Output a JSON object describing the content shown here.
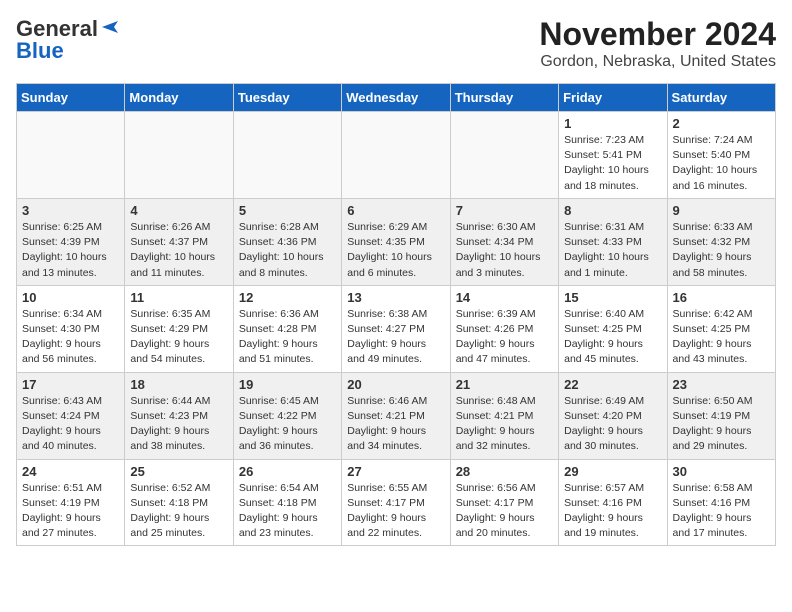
{
  "logo": {
    "line1": "General",
    "line2": "Blue"
  },
  "title": "November 2024",
  "subtitle": "Gordon, Nebraska, United States",
  "weekdays": [
    "Sunday",
    "Monday",
    "Tuesday",
    "Wednesday",
    "Thursday",
    "Friday",
    "Saturday"
  ],
  "weeks": [
    [
      {
        "day": "",
        "info": ""
      },
      {
        "day": "",
        "info": ""
      },
      {
        "day": "",
        "info": ""
      },
      {
        "day": "",
        "info": ""
      },
      {
        "day": "",
        "info": ""
      },
      {
        "day": "1",
        "info": "Sunrise: 7:23 AM\nSunset: 5:41 PM\nDaylight: 10 hours and 18 minutes."
      },
      {
        "day": "2",
        "info": "Sunrise: 7:24 AM\nSunset: 5:40 PM\nDaylight: 10 hours and 16 minutes."
      }
    ],
    [
      {
        "day": "3",
        "info": "Sunrise: 6:25 AM\nSunset: 4:39 PM\nDaylight: 10 hours and 13 minutes."
      },
      {
        "day": "4",
        "info": "Sunrise: 6:26 AM\nSunset: 4:37 PM\nDaylight: 10 hours and 11 minutes."
      },
      {
        "day": "5",
        "info": "Sunrise: 6:28 AM\nSunset: 4:36 PM\nDaylight: 10 hours and 8 minutes."
      },
      {
        "day": "6",
        "info": "Sunrise: 6:29 AM\nSunset: 4:35 PM\nDaylight: 10 hours and 6 minutes."
      },
      {
        "day": "7",
        "info": "Sunrise: 6:30 AM\nSunset: 4:34 PM\nDaylight: 10 hours and 3 minutes."
      },
      {
        "day": "8",
        "info": "Sunrise: 6:31 AM\nSunset: 4:33 PM\nDaylight: 10 hours and 1 minute."
      },
      {
        "day": "9",
        "info": "Sunrise: 6:33 AM\nSunset: 4:32 PM\nDaylight: 9 hours and 58 minutes."
      }
    ],
    [
      {
        "day": "10",
        "info": "Sunrise: 6:34 AM\nSunset: 4:30 PM\nDaylight: 9 hours and 56 minutes."
      },
      {
        "day": "11",
        "info": "Sunrise: 6:35 AM\nSunset: 4:29 PM\nDaylight: 9 hours and 54 minutes."
      },
      {
        "day": "12",
        "info": "Sunrise: 6:36 AM\nSunset: 4:28 PM\nDaylight: 9 hours and 51 minutes."
      },
      {
        "day": "13",
        "info": "Sunrise: 6:38 AM\nSunset: 4:27 PM\nDaylight: 9 hours and 49 minutes."
      },
      {
        "day": "14",
        "info": "Sunrise: 6:39 AM\nSunset: 4:26 PM\nDaylight: 9 hours and 47 minutes."
      },
      {
        "day": "15",
        "info": "Sunrise: 6:40 AM\nSunset: 4:25 PM\nDaylight: 9 hours and 45 minutes."
      },
      {
        "day": "16",
        "info": "Sunrise: 6:42 AM\nSunset: 4:25 PM\nDaylight: 9 hours and 43 minutes."
      }
    ],
    [
      {
        "day": "17",
        "info": "Sunrise: 6:43 AM\nSunset: 4:24 PM\nDaylight: 9 hours and 40 minutes."
      },
      {
        "day": "18",
        "info": "Sunrise: 6:44 AM\nSunset: 4:23 PM\nDaylight: 9 hours and 38 minutes."
      },
      {
        "day": "19",
        "info": "Sunrise: 6:45 AM\nSunset: 4:22 PM\nDaylight: 9 hours and 36 minutes."
      },
      {
        "day": "20",
        "info": "Sunrise: 6:46 AM\nSunset: 4:21 PM\nDaylight: 9 hours and 34 minutes."
      },
      {
        "day": "21",
        "info": "Sunrise: 6:48 AM\nSunset: 4:21 PM\nDaylight: 9 hours and 32 minutes."
      },
      {
        "day": "22",
        "info": "Sunrise: 6:49 AM\nSunset: 4:20 PM\nDaylight: 9 hours and 30 minutes."
      },
      {
        "day": "23",
        "info": "Sunrise: 6:50 AM\nSunset: 4:19 PM\nDaylight: 9 hours and 29 minutes."
      }
    ],
    [
      {
        "day": "24",
        "info": "Sunrise: 6:51 AM\nSunset: 4:19 PM\nDaylight: 9 hours and 27 minutes."
      },
      {
        "day": "25",
        "info": "Sunrise: 6:52 AM\nSunset: 4:18 PM\nDaylight: 9 hours and 25 minutes."
      },
      {
        "day": "26",
        "info": "Sunrise: 6:54 AM\nSunset: 4:18 PM\nDaylight: 9 hours and 23 minutes."
      },
      {
        "day": "27",
        "info": "Sunrise: 6:55 AM\nSunset: 4:17 PM\nDaylight: 9 hours and 22 minutes."
      },
      {
        "day": "28",
        "info": "Sunrise: 6:56 AM\nSunset: 4:17 PM\nDaylight: 9 hours and 20 minutes."
      },
      {
        "day": "29",
        "info": "Sunrise: 6:57 AM\nSunset: 4:16 PM\nDaylight: 9 hours and 19 minutes."
      },
      {
        "day": "30",
        "info": "Sunrise: 6:58 AM\nSunset: 4:16 PM\nDaylight: 9 hours and 17 minutes."
      }
    ]
  ]
}
